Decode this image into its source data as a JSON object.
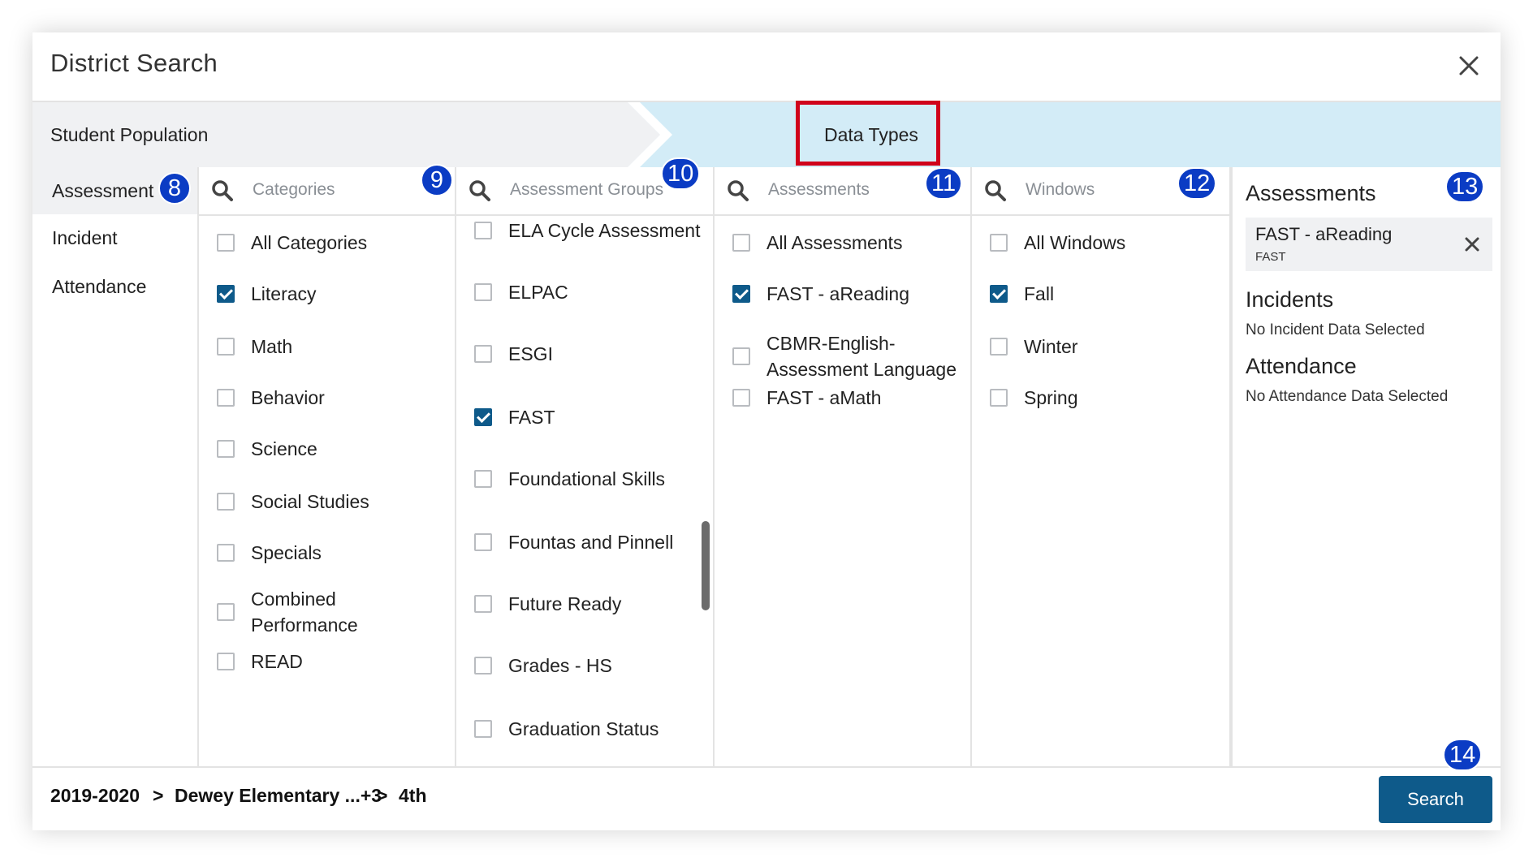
{
  "modal": {
    "title": "District Search"
  },
  "steps": [
    {
      "label": "Student Population"
    },
    {
      "label": "Data Types"
    }
  ],
  "badges": [
    "8",
    "9",
    "10",
    "11",
    "12",
    "13",
    "14"
  ],
  "sidenav": {
    "items": [
      {
        "label": "Assessment"
      },
      {
        "label": "Incident"
      },
      {
        "label": "Attendance"
      }
    ]
  },
  "categories": {
    "placeholder": "Categories",
    "options": [
      {
        "label": "All Categories",
        "checked": false
      },
      {
        "label": "Literacy",
        "checked": true
      },
      {
        "label": "Math",
        "checked": false
      },
      {
        "label": "Behavior",
        "checked": false
      },
      {
        "label": "Science",
        "checked": false
      },
      {
        "label": "Social Studies",
        "checked": false
      },
      {
        "label": "Specials",
        "checked": false
      },
      {
        "label": "Combined",
        "label2": "Performance",
        "checked": false
      },
      {
        "label": "READ",
        "checked": false
      }
    ]
  },
  "assessment_groups": {
    "placeholder": "Assessment Groups",
    "options": [
      {
        "label": "ELA Cycle Assessment",
        "checked": false
      },
      {
        "label": "ELPAC",
        "checked": false
      },
      {
        "label": "ESGI",
        "checked": false
      },
      {
        "label": "FAST",
        "checked": true
      },
      {
        "label": "Foundational Skills",
        "checked": false
      },
      {
        "label": "Fountas and Pinnell",
        "checked": false
      },
      {
        "label": "Future Ready",
        "checked": false
      },
      {
        "label": "Grades - HS",
        "checked": false
      },
      {
        "label": "Graduation Status",
        "checked": false
      }
    ]
  },
  "assessments": {
    "placeholder": "Assessments",
    "options": [
      {
        "label": "All Assessments",
        "checked": false
      },
      {
        "label": "FAST - aReading",
        "checked": true
      },
      {
        "label": "CBMR-English-",
        "label2": "Assessment Language",
        "checked": false
      },
      {
        "label": "FAST - aMath",
        "checked": false
      }
    ]
  },
  "windows": {
    "placeholder": "Windows",
    "options": [
      {
        "label": "All Windows",
        "checked": false
      },
      {
        "label": "Fall",
        "checked": true
      },
      {
        "label": "Winter",
        "checked": false
      },
      {
        "label": "Spring",
        "checked": false
      }
    ]
  },
  "summary": {
    "assessments_heading": "Assessments",
    "chip": {
      "title": "FAST - aReading",
      "subtitle": "FAST"
    },
    "incidents_heading": "Incidents",
    "incidents_empty": "No Incident Data Selected",
    "attendance_heading": "Attendance",
    "attendance_empty": "No Attendance Data Selected"
  },
  "footer": {
    "breadcrumb": [
      "2019-2020",
      ">",
      "Dewey Elementary ...+3",
      ">",
      "4th"
    ],
    "search_label": "Search"
  },
  "colors": {
    "primary": "#0e5a8a",
    "badge": "#0b3cc4",
    "highlight_box": "#d0021b",
    "step_active_bg": "#d3ecf7",
    "step_inactive_bg": "#f0f1f3"
  },
  "icons": {
    "close": "close-icon",
    "search": "search-icon",
    "remove": "remove-icon"
  }
}
